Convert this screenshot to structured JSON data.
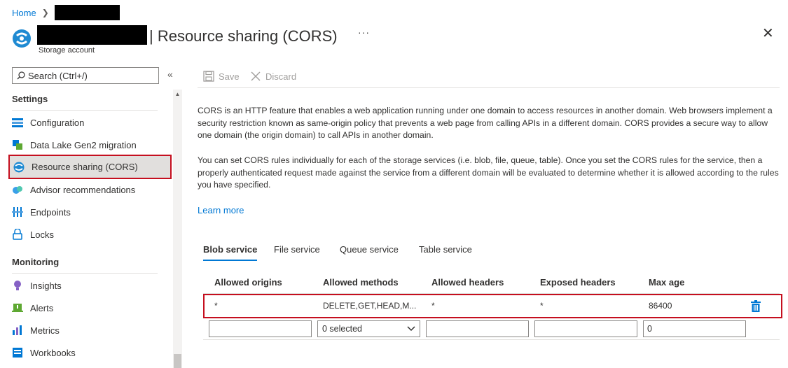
{
  "breadcrumb": {
    "home": "Home"
  },
  "header": {
    "title": "| Resource sharing (CORS)",
    "subtitle": "Storage account",
    "more": "···",
    "close": "✕"
  },
  "sidebar": {
    "search_placeholder": "Search (Ctrl+/)",
    "collapse": "«",
    "sections": [
      {
        "title": "Settings",
        "items": [
          {
            "label": "Configuration",
            "icon": "configuration-icon"
          },
          {
            "label": "Data Lake Gen2 migration",
            "icon": "data-lake-icon"
          },
          {
            "label": "Resource sharing (CORS)",
            "icon": "cors-icon",
            "selected": true
          },
          {
            "label": "Advisor recommendations",
            "icon": "advisor-icon"
          },
          {
            "label": "Endpoints",
            "icon": "endpoints-icon"
          },
          {
            "label": "Locks",
            "icon": "lock-icon"
          }
        ]
      },
      {
        "title": "Monitoring",
        "items": [
          {
            "label": "Insights",
            "icon": "insights-icon"
          },
          {
            "label": "Alerts",
            "icon": "alerts-icon"
          },
          {
            "label": "Metrics",
            "icon": "metrics-icon"
          },
          {
            "label": "Workbooks",
            "icon": "workbooks-icon"
          }
        ]
      }
    ]
  },
  "toolbar": {
    "save": "Save",
    "discard": "Discard"
  },
  "content": {
    "para1": "CORS is an HTTP feature that enables a web application running under one domain to access resources in another domain. Web browsers implement a security restriction known as same-origin policy that prevents a web page from calling APIs in a different domain. CORS provides a secure way to allow one domain (the origin domain) to call APIs in another domain.",
    "para2": "You can set CORS rules individually for each of the storage services (i.e. blob, file, queue, table). Once you set the CORS rules for the service, then a properly authenticated request made against the service from a different domain will be evaluated to determine whether it is allowed according to the rules you have specified.",
    "learn_more": "Learn more"
  },
  "tabs": [
    "Blob service",
    "File service",
    "Queue service",
    "Table service"
  ],
  "table": {
    "columns": [
      "Allowed origins",
      "Allowed methods",
      "Allowed headers",
      "Exposed headers",
      "Max age"
    ],
    "row": [
      "*",
      "DELETE,GET,HEAD,M...",
      "*",
      "*",
      "86400"
    ],
    "new_row": {
      "origins": "",
      "methods": "0 selected",
      "headers": "",
      "exposed": "",
      "max_age": "0"
    }
  },
  "colors": {
    "accent": "#0078d4",
    "highlight": "#c50f1f"
  }
}
